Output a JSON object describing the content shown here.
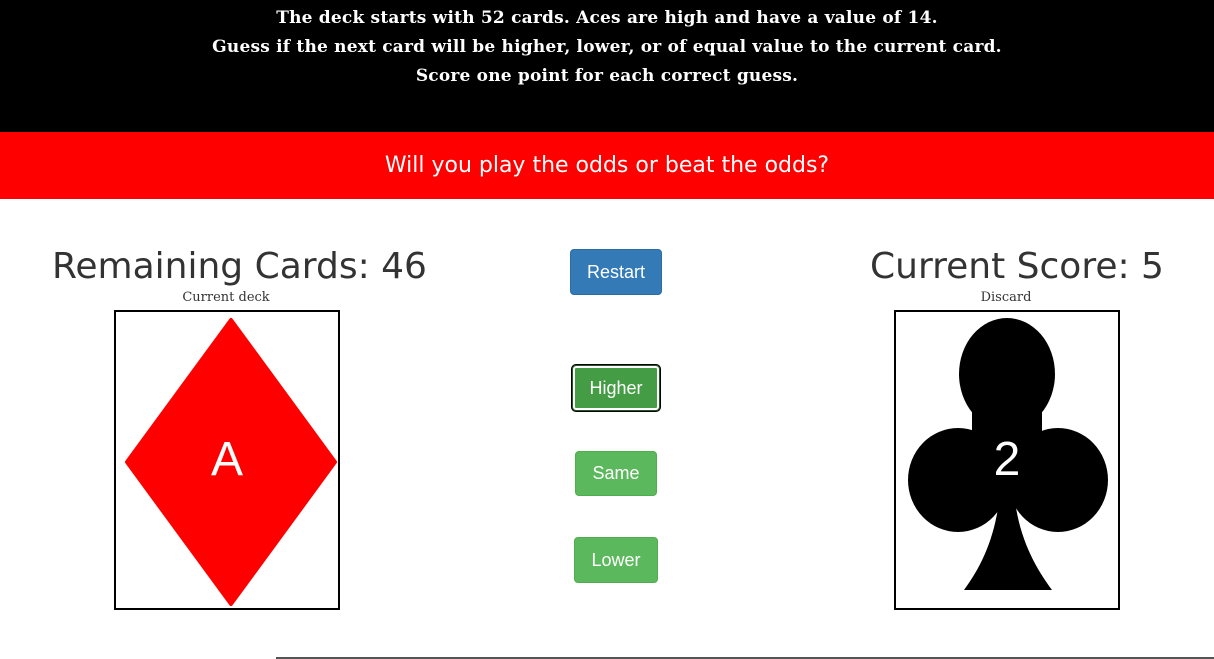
{
  "header": {
    "rules": [
      "The deck starts with 52 cards. Aces are high and have a value of 14.",
      "Guess if the next card will be higher, lower, or of equal value to the current card.",
      "Score one point for each correct guess."
    ],
    "tagline": "Will you play the odds or beat the odds?"
  },
  "game": {
    "remaining_label": "Remaining Cards: 46",
    "score_label": "Current Score: 5",
    "deck_caption": "Current deck",
    "discard_caption": "Discard",
    "current_card": {
      "rank": "A",
      "suit": "diamond",
      "color": "#ff0000"
    },
    "discard_card": {
      "rank": "2",
      "suit": "club",
      "color": "#000000"
    }
  },
  "controls": {
    "restart": "Restart",
    "higher": "Higher",
    "same": "Same",
    "lower": "Lower"
  },
  "colors": {
    "topbar": "#000000",
    "redbar": "#ff0000",
    "restart_button": "#337ab7",
    "guess_button": "#5cb85c"
  }
}
